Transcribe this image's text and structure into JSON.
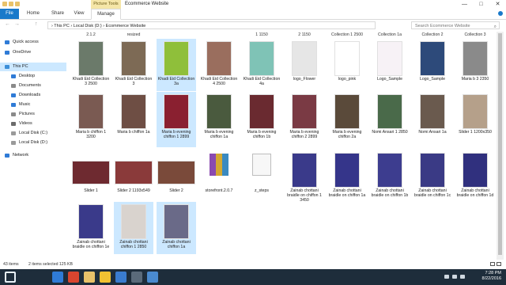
{
  "titlebar": {
    "context_tab": "Picture Tools",
    "window_title": "Ecommerce Website",
    "minimize": "—",
    "maximize": "□",
    "close": "✕"
  },
  "ribbon": {
    "tabs": [
      {
        "label": "File"
      },
      {
        "label": "Home"
      },
      {
        "label": "Share"
      },
      {
        "label": "View"
      },
      {
        "label": "Manage"
      }
    ]
  },
  "address": {
    "back": "←",
    "forward": "→",
    "up": "↑",
    "path": "›  This PC  ›  Local Disk (D:)  ›  Ecommerce Website",
    "search_placeholder": "Search Ecommerce Website"
  },
  "nav": {
    "items": [
      {
        "label": "Quick access",
        "icon": "star-icon",
        "color": "#2f7bd6"
      },
      {
        "label": "OneDrive",
        "icon": "cloud-icon",
        "color": "#2f7bd6"
      },
      {
        "label": "This PC",
        "icon": "computer-icon",
        "color": "#3c8fd8",
        "selected": true
      },
      {
        "label": "Desktop",
        "icon": "desktop-icon",
        "color": "#2f7bd6"
      },
      {
        "label": "Documents",
        "icon": "documents-icon",
        "color": "#8a8a8a"
      },
      {
        "label": "Downloads",
        "icon": "downloads-icon",
        "color": "#2f7bd6"
      },
      {
        "label": "Music",
        "icon": "music-icon",
        "color": "#2f7bd6"
      },
      {
        "label": "Pictures",
        "icon": "pictures-icon",
        "color": "#8a8a8a"
      },
      {
        "label": "Videos",
        "icon": "videos-icon",
        "color": "#6b6b6b"
      },
      {
        "label": "Local Disk (C:)",
        "icon": "drive-icon",
        "color": "#9a9a9a"
      },
      {
        "label": "Local Disk (D:)",
        "icon": "drive-icon",
        "color": "#9a9a9a"
      },
      {
        "label": "Network",
        "icon": "network-icon",
        "color": "#2f7bd6"
      }
    ]
  },
  "top_labels": [
    "2.1.2",
    "resized",
    "",
    "",
    "1 1150",
    "2 1150",
    "Collection 1 2500",
    "Collection 1a",
    "Collection 2",
    "Collection 3"
  ],
  "rows": [
    [
      {
        "label": "Khadi Eid Collection 3 2500",
        "color": "#6b7a6a"
      },
      {
        "label": "Khadi Eid Collection 3",
        "color": "#7d6a55"
      },
      {
        "label": "Khadi Eid Collection 3a",
        "color": "#8fbf3a",
        "selected": true
      },
      {
        "label": "Khadi Eid Collection 4 2500",
        "color": "#9a6e5e"
      },
      {
        "label": "Khadi Eid Collection 4a",
        "color": "#7fc3b6"
      },
      {
        "label": "logo_Flower",
        "color": "#e6e6e6"
      },
      {
        "label": "logo_pink",
        "color": "#ffffff"
      },
      {
        "label": "Logo_Sample",
        "color": "#f7f2f6"
      },
      {
        "label": "Logo_Sample",
        "color": "#2d4a7a"
      },
      {
        "label": "Maria b 3 2350",
        "color": "#8a8a8a"
      }
    ],
    [
      {
        "label": "Maria b chiffon 1 3200",
        "color": "#7a5a52"
      },
      {
        "label": "Maria b chiffon 1a",
        "color": "#6e4e44"
      },
      {
        "label": "Maria b evening chiffon 1 2899",
        "color": "#8a2030",
        "selected": true
      },
      {
        "label": "Maria b evening chiffon 1a",
        "color": "#4a5a3e"
      },
      {
        "label": "Maria b evening chiffon 1b",
        "color": "#6a2a30"
      },
      {
        "label": "Maria b evening chiffon 2 2899",
        "color": "#7a3a44"
      },
      {
        "label": "Maria b evening chiffon 2a",
        "color": "#5a4a3a"
      },
      {
        "label": "Nomi Ansari 1 2850",
        "color": "#4a6a4a"
      },
      {
        "label": "Nomi Ansari 1a",
        "color": "#6a5a4e"
      },
      {
        "label": "Slider 1 1200x350",
        "color": "#b5a08a"
      }
    ],
    [
      {
        "label": "Slider 1",
        "color": "#6e2a30"
      },
      {
        "label": "Slider 2 1193x549",
        "color": "#8a3a3a"
      },
      {
        "label": "Slider 2",
        "color": "#7a4a3a"
      },
      {
        "label": "storefront.2.0.7",
        "color": "#f2f2f2",
        "archive": true
      },
      {
        "label": "z_steps",
        "color": "#f7f7f7",
        "doc": true
      },
      {
        "label": "Zainab chottani braidle on chiffon 1 3450",
        "color": "#3a3a8a"
      },
      {
        "label": "Zainab chottani braidle on chiffon 1a",
        "color": "#35358a"
      },
      {
        "label": "Zainab chottani braidle on chiffon 1b",
        "color": "#3d3d8f"
      },
      {
        "label": "Zainab chottani braidle on chiffon 1c",
        "color": "#3a3a85"
      },
      {
        "label": "Zainab chottani braidle on chiffon 1d",
        "color": "#30307e"
      }
    ],
    [
      {
        "label": "Zainab chottani braidle on chiffon 1e",
        "color": "#3a3a8a"
      },
      {
        "label": "Zainab chottani chiffon 1 2850",
        "color": "#d9d3ce",
        "selected": true
      },
      {
        "label": "Zainab chottani chiffon 1a",
        "color": "#6a6a88",
        "selected": true
      }
    ]
  ],
  "status": {
    "count": "43 items",
    "selection": "2 items selected  125 KB"
  },
  "taskbar": {
    "time": "7:28 PM",
    "date": "8/22/2016",
    "apps": [
      {
        "icon": "windows-start-icon",
        "color": "#1e2d3b"
      },
      {
        "icon": "search-icon",
        "color": "#1e2d3b"
      },
      {
        "icon": "task-view-icon",
        "color": "#1e2d3b"
      },
      {
        "icon": "edge-icon",
        "color": "#2f7bd6"
      },
      {
        "icon": "chrome-icon",
        "color": "#d9452f"
      },
      {
        "icon": "file-explorer-icon",
        "color": "#e8c26a"
      },
      {
        "icon": "norton-icon",
        "color": "#f1c232"
      },
      {
        "icon": "photoshop-icon",
        "color": "#3a7ccf"
      },
      {
        "icon": "media-icon",
        "color": "#5a6a7a"
      },
      {
        "icon": "chat-icon",
        "color": "#4a8acf"
      }
    ]
  }
}
